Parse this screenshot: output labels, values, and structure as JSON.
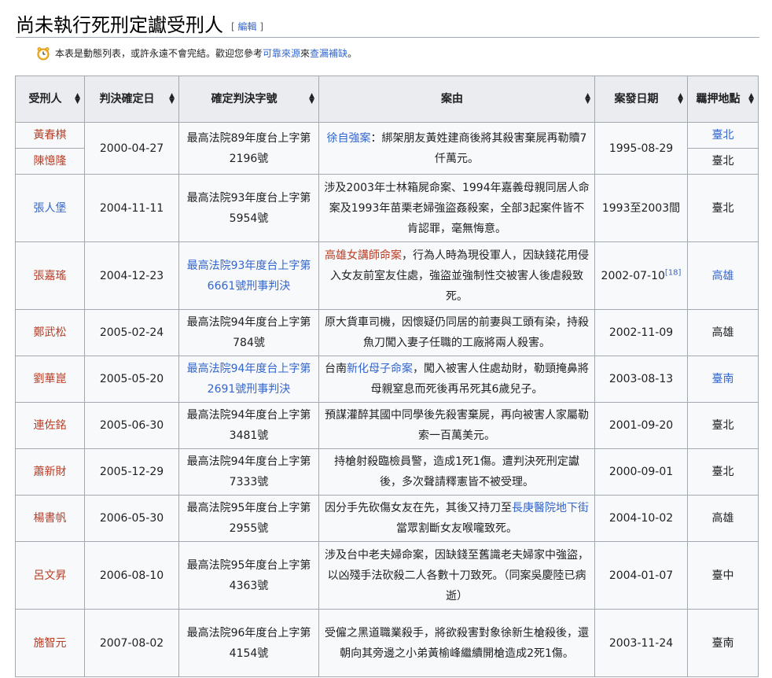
{
  "heading": {
    "title": "尚未執行死刑定讞受刑人",
    "edit_open": "[",
    "edit_label": "編輯",
    "edit_close": "]"
  },
  "notice": {
    "icon": "clock-icon",
    "text_before": "本表是動態列表，或許永遠不會完結。歡迎您參考",
    "link1": "可靠來源",
    "text_mid": "來",
    "link2": "查漏補缺",
    "text_after": "。"
  },
  "table": {
    "headers": [
      "受刑人",
      "判決確定日",
      "確定判決字號",
      "案由",
      "案發日期",
      "羈押地點"
    ],
    "rows": [
      {
        "name": "黃春棋",
        "name_style": "red",
        "name2": "陳憶隆",
        "name2_style": "red",
        "date": "2000-04-27",
        "ruling": "最高法院89年度台上字第2196號",
        "ruling_link": false,
        "case_link": "徐自強案",
        "case_text": "：綁架朋友黃姓建商後將其殺害棄屍再勒贖7仟萬元。",
        "crime_date": "1995-08-29",
        "place": "臺北",
        "place_link": true,
        "place2": "臺北",
        "place2_link": false
      },
      {
        "name": "張人堡",
        "name_style": "blue",
        "date": "2004-11-11",
        "ruling": "最高法院93年度台上字第5954號",
        "ruling_link": false,
        "case_text": "涉及2003年士林箱屍命案、1994年嘉義母親同居人命案及1993年苗栗老婦強盜姦殺案，全部3起案件皆不肯認罪，毫無悔意。",
        "crime_date": "1993至2003間",
        "place": "臺北",
        "place_link": false
      },
      {
        "name": "張嘉瑤",
        "name_style": "red",
        "date": "2004-12-23",
        "ruling": "最高法院93年度台上字第6661號刑事判決",
        "ruling_link": true,
        "case_link": "高雄女講師命案",
        "case_link_style": "red",
        "case_text": "，行為人時為現役軍人，因缺錢花用侵入女友前室友住處，強盜並強制性交被害人後虐殺致死。",
        "crime_date": "2002-07-10",
        "crime_ref": "[18]",
        "place": "高雄",
        "place_link": true
      },
      {
        "name": "鄭武松",
        "name_style": "red",
        "date": "2005-02-24",
        "ruling": "最高法院94年度台上字第784號",
        "ruling_link": false,
        "case_text": "原大貨車司機，因懷疑仍同居的前妻與工頭有染，持殺魚刀闖入妻子任職的工廠將兩人殺害。",
        "crime_date": "2002-11-09",
        "place": "高雄",
        "place_link": false
      },
      {
        "name": "劉華崑",
        "name_style": "red",
        "date": "2005-05-20",
        "ruling": "最高法院94年度台上字第2691號刑事判決",
        "ruling_link": true,
        "case_pre": "台南",
        "case_link": "新化母子命案",
        "case_link_style": "blue",
        "case_text": "，闖入被害人住處劫財，勒頸掩鼻將母親窒息而死後再吊死其6歲兒子。",
        "crime_date": "2003-08-13",
        "place": "臺南",
        "place_link": true
      },
      {
        "name": "連佐銘",
        "name_style": "red",
        "date": "2005-06-30",
        "ruling": "最高法院94年度台上字第3481號",
        "ruling_link": false,
        "case_text": "預謀灌醉其國中同學後先殺害棄屍，再向被害人家屬勒索一百萬美元。",
        "crime_date": "2001-09-20",
        "place": "臺北",
        "place_link": false
      },
      {
        "name": "蕭新財",
        "name_style": "red",
        "date": "2005-12-29",
        "ruling": "最高法院94年度台上字第7333號",
        "ruling_link": false,
        "case_text": "持槍射殺臨檢員警，造成1死1傷。遭判決死刑定讞後，多次聲請釋憲皆不被受理。",
        "crime_date": "2000-09-01",
        "place": "臺北",
        "place_link": false
      },
      {
        "name": "楊書帆",
        "name_style": "red",
        "date": "2006-05-30",
        "ruling": "最高法院95年度台上字第2955號",
        "ruling_link": false,
        "case_text1": "因分手先砍傷女友在先，其後又持刀至",
        "case_link": "長庚醫院地下街",
        "case_link_style": "blue",
        "case_text": "當眾割斷女友喉嚨致死。",
        "crime_date": "2004-10-02",
        "place": "高雄",
        "place_link": false
      },
      {
        "name": "呂文昇",
        "name_style": "red",
        "date": "2006-08-10",
        "ruling": "最高法院95年度台上字第4363號",
        "ruling_link": false,
        "case_text": "涉及台中老夫婦命案，因缺錢至舊識老夫婦家中強盜，以凶殘手法砍殺二人各數十刀致死。（同案吳慶陸已病逝）",
        "crime_date": "2004-01-07",
        "place": "臺中",
        "place_link": false
      },
      {
        "name": "施智元",
        "name_style": "red",
        "date": "2007-08-02",
        "ruling": "最高法院96年度台上字第4154號",
        "ruling_link": false,
        "case_text": "受僱之黑道職業殺手，將欲殺害對象徐新生槍殺後，還朝向其旁邊之小弟黃榆峰繼續開槍造成2死1傷。",
        "crime_date": "2003-11-24",
        "place": "臺南",
        "place_link": false
      }
    ]
  }
}
